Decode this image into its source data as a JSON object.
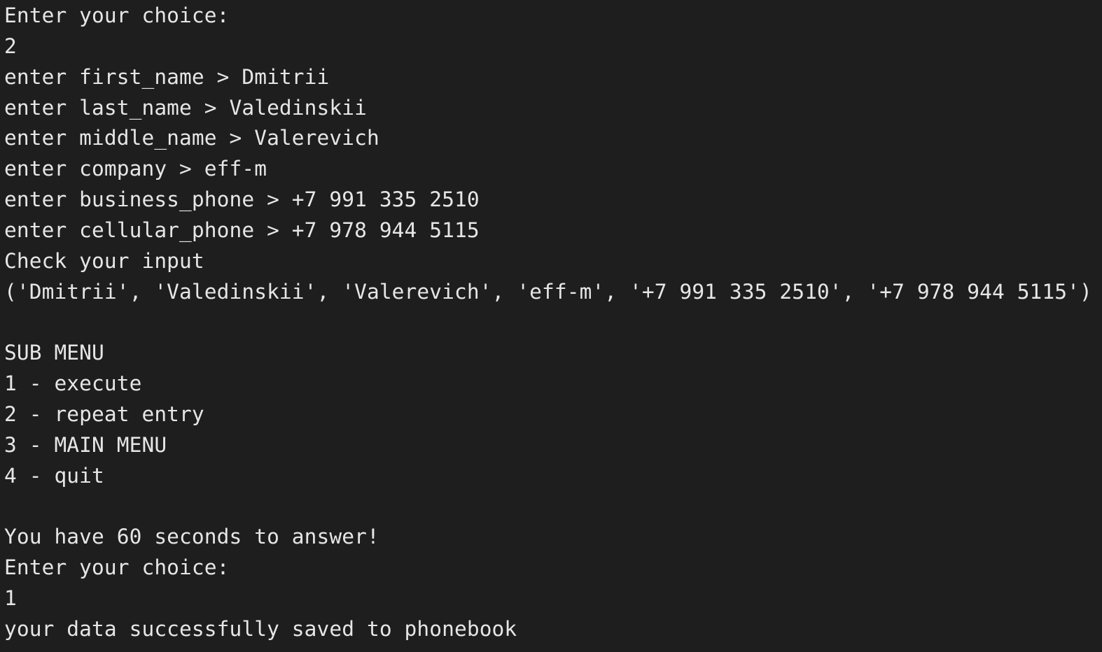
{
  "terminal": {
    "lines": [
      "Enter your choice:",
      "2",
      "enter first_name > Dmitrii",
      "enter last_name > Valedinskii",
      "enter middle_name > Valerevich",
      "enter company > eff-m",
      "enter business_phone > +7 991 335 2510",
      "enter cellular_phone > +7 978 944 5115",
      "Check your input",
      "('Dmitrii', 'Valedinskii', 'Valerevich', 'eff-m', '+7 991 335 2510', '+7 978 944 5115')",
      "",
      "SUB MENU",
      "1 - execute",
      "2 - repeat entry",
      "3 - MAIN MENU",
      "4 - quit",
      "",
      "You have 60 seconds to answer!",
      "Enter your choice:",
      "1",
      "your data successfully saved to phonebook"
    ]
  }
}
